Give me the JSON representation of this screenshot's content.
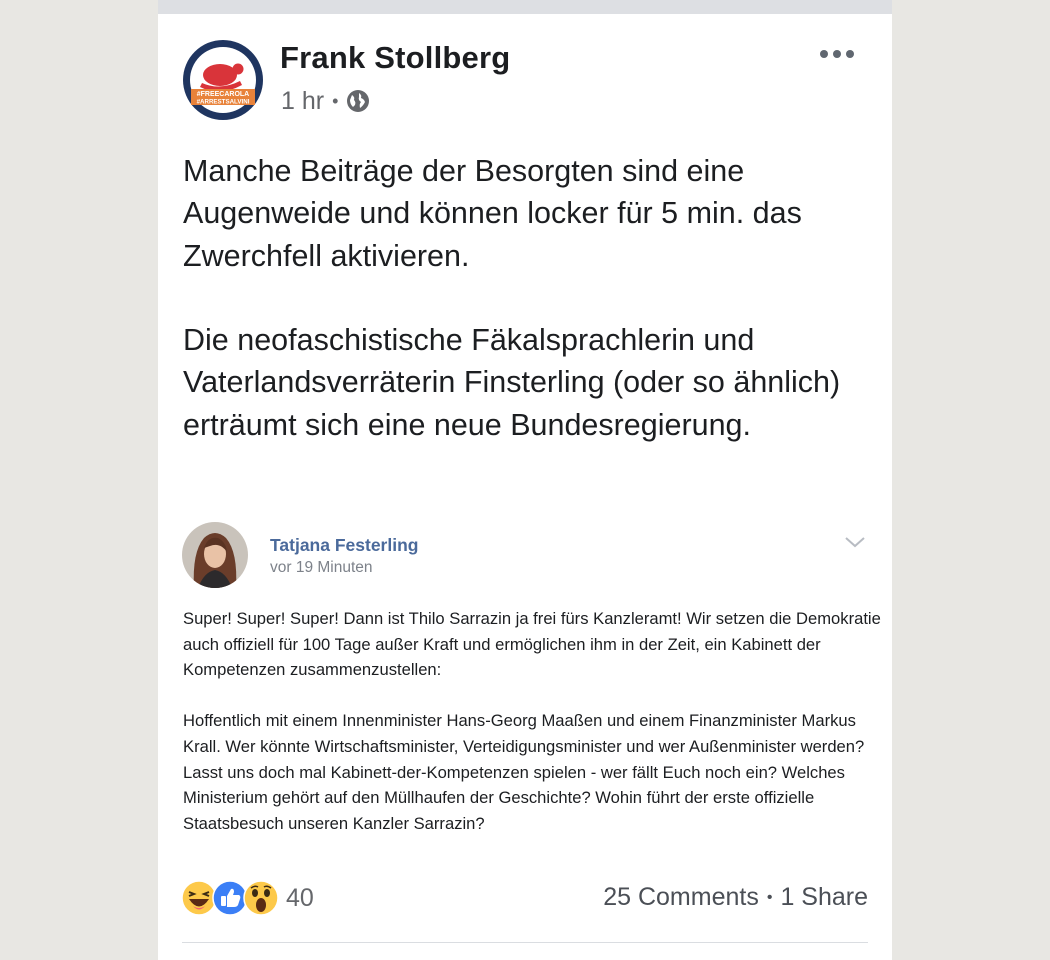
{
  "post": {
    "author": "Frank Stollberg",
    "time": "1 hr",
    "separator": "•",
    "badge_line1": "#FREECAROLA",
    "badge_line2": "#ARRESTSALVINI",
    "text": "Manche Beiträge der Besorgten sind eine Augenweide und können locker für 5 min. das Zwerchfell aktivieren.\n\nDie neofaschistische Fäkalsprachlerin und Vaterlandsverräterin Finsterling (oder so ähnlich) erträumt sich eine neue Bundesregierung.",
    "icons": {
      "more": "more-options-icon",
      "privacy": "globe-icon"
    }
  },
  "shared": {
    "author": "Tatjana Festerling",
    "time": "vor 19 Minuten",
    "paragraph1": "Super! Super! Super! Dann ist Thilo Sarrazin ja frei fürs Kanzleramt! Wir setzen die Demokratie auch offiziell für 100 Tage außer Kraft und ermöglichen ihm in der Zeit, ein Kabinett der Kompetenzen zusammenzustellen:",
    "paragraph2": "Hoffentlich mit einem Innenminister Hans-Georg Maaßen und einem Finanzminister Markus Krall. Wer könnte Wirtschaftsminister, Verteidigungsminister und wer Außenminister werden? Lasst uns doch mal Kabinett-der-Kompetenzen spielen - wer fällt Euch noch ein? Welches Ministerium gehört auf den Müllhaufen der Geschichte? Wohin führt der erste offizielle Staatsbesuch unseren Kanzler Sarrazin?"
  },
  "engagement": {
    "reaction_count": "40",
    "reactions": [
      "haha-icon",
      "like-icon",
      "wow-icon"
    ],
    "comments": "25 Comments",
    "separator": "•",
    "shares": "1 Share"
  },
  "colors": {
    "name_link": "#4b6a9b",
    "badge_navy": "#1f3560",
    "badge_red": "#d9343a",
    "badge_orange": "#e8823a",
    "like_blue": "#3b7ff6",
    "emoji_yellow": "#fdc94a"
  }
}
